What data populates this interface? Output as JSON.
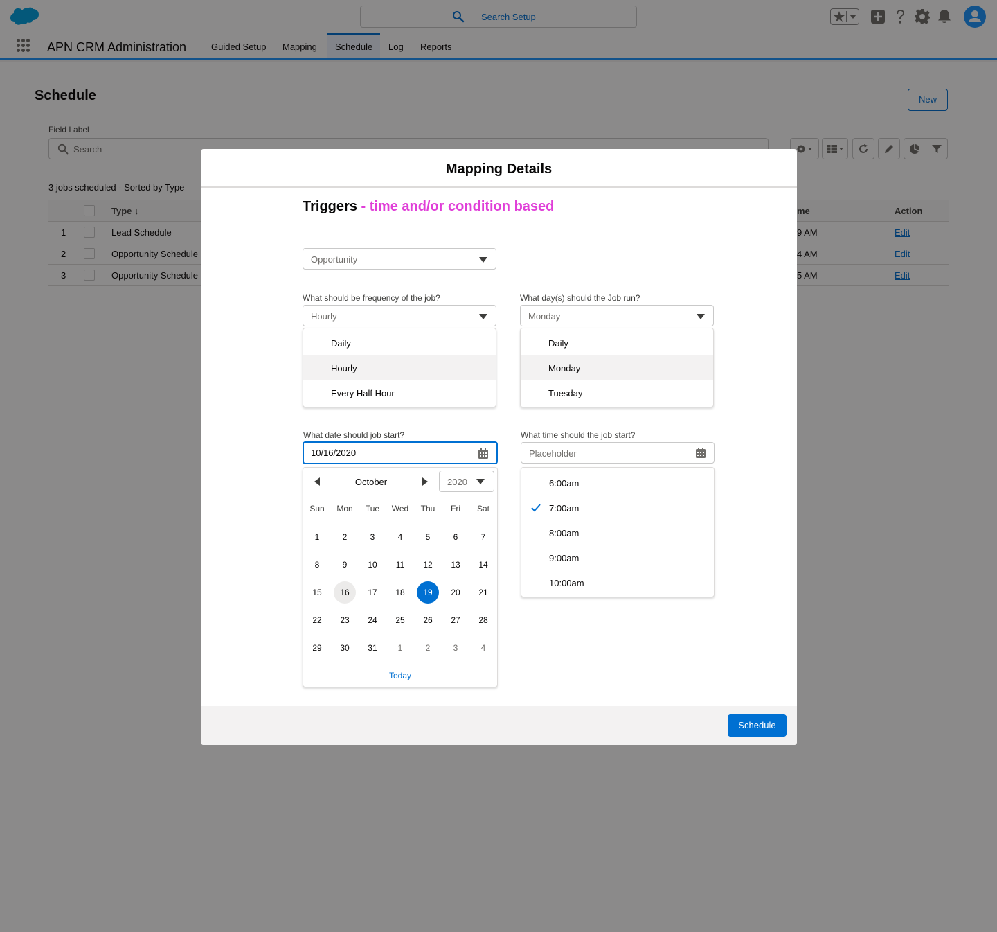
{
  "header": {
    "search_placeholder": "Search Setup",
    "colors": {
      "brand": "#00a1e0",
      "accent": "#0070d2",
      "highlight": "#e03fd8"
    }
  },
  "app_nav": {
    "app_name": "APN CRM Administration",
    "tabs": [
      "Guided Setup",
      "Mapping",
      "Schedule",
      "Log",
      "Reports"
    ],
    "active_tab": "Schedule"
  },
  "page": {
    "title": "Schedule",
    "new_button": "New",
    "field_label": "Field Label",
    "search_placeholder": "Search",
    "summary": "3 jobs scheduled - Sorted by Type",
    "table": {
      "columns": [
        "Type ↓",
        "me",
        "Action"
      ],
      "rows": [
        {
          "num": "1",
          "type": "Lead Schedule",
          "time": "9 AM",
          "action": "Edit"
        },
        {
          "num": "2",
          "type": "Opportunity Schedule",
          "time": "4 AM",
          "action": "Edit"
        },
        {
          "num": "3",
          "type": "Opportunity Schedule",
          "time": "5 AM",
          "action": "Edit"
        }
      ]
    }
  },
  "modal": {
    "title": "Mapping Details",
    "heading": "Triggers",
    "heading_sub": " - time and/or condition based",
    "object_select": "Opportunity",
    "frequency": {
      "label": "What should be frequency of  the job?",
      "value": "Hourly",
      "options": [
        "Daily",
        "Hourly",
        "Every Half Hour"
      ],
      "selected": "Hourly"
    },
    "days": {
      "label": "What day(s) should the Job run?",
      "value": "Monday",
      "options": [
        "Daily",
        "Monday",
        "Tuesday"
      ],
      "selected": "Monday"
    },
    "start_date": {
      "label": "What date should job start?",
      "value": "10/16/2020"
    },
    "calendar": {
      "month": "October",
      "year": "2020",
      "weekdays": [
        "Sun",
        "Mon",
        "Tue",
        "Wed",
        "Thu",
        "Fri",
        "Sat"
      ],
      "weeks": [
        [
          "",
          "",
          "",
          "",
          "",
          "",
          ""
        ],
        [
          "1",
          "2",
          "3",
          "4",
          "5",
          "6",
          "7"
        ],
        [
          "8",
          "9",
          "10",
          "11",
          "12",
          "13",
          "14"
        ],
        [
          "15",
          "16",
          "17",
          "18",
          "19",
          "20",
          "21"
        ],
        [
          "22",
          "23",
          "24",
          "25",
          "26",
          "27",
          "28"
        ],
        [
          "29",
          "30",
          "31",
          "1",
          "2",
          "3",
          "4"
        ]
      ],
      "today_day": "16",
      "selected_day": "19",
      "today_link": "Today"
    },
    "start_time": {
      "label": "What time should the job start?",
      "placeholder": "Placeholder",
      "options": [
        "6:00am",
        "7:00am",
        "8:00am",
        "9:00am",
        "10:00am"
      ],
      "selected": "7:00am"
    },
    "schedule_button": "Schedule"
  }
}
